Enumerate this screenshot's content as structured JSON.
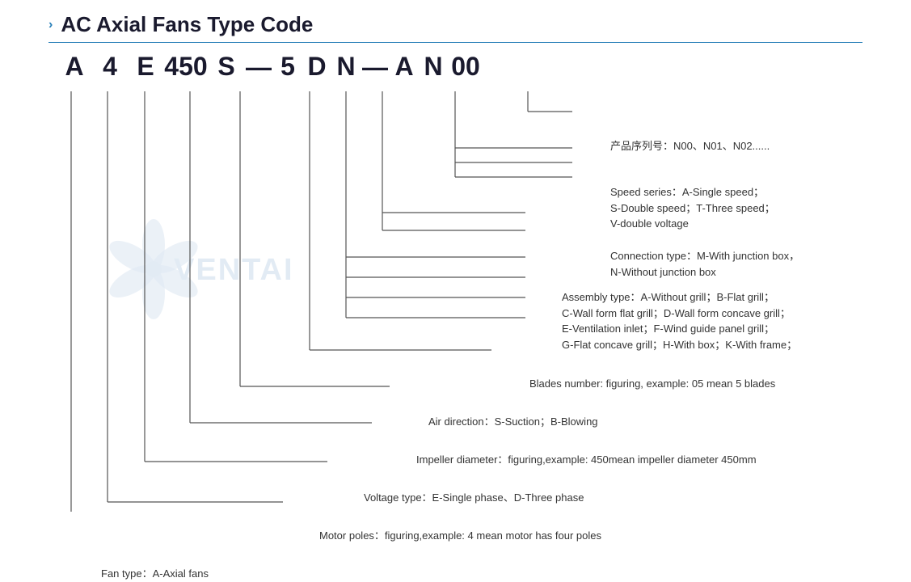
{
  "title": {
    "chevron": "›",
    "text": "AC Axial Fans Type Code"
  },
  "code_letters": [
    {
      "char": "A",
      "id": "fan-type"
    },
    {
      "char": "4",
      "id": "motor-poles"
    },
    {
      "char": "E",
      "id": "voltage-type"
    },
    {
      "char": "450",
      "id": "impeller-dia"
    },
    {
      "char": "S",
      "id": "air-direction"
    },
    {
      "char": "—",
      "id": "dash1"
    },
    {
      "char": "5",
      "id": "blades"
    },
    {
      "char": "D",
      "id": "assembly"
    },
    {
      "char": "N",
      "id": "connection"
    },
    {
      "char": "—",
      "id": "dash2"
    },
    {
      "char": "A",
      "id": "speed"
    },
    {
      "char": "N",
      "id": "speed2"
    },
    {
      "char": "00",
      "id": "product-series"
    }
  ],
  "labels": {
    "product_series": "产品序列号：N00、N01、N02......",
    "speed_title": "Speed series：A-Single speed；",
    "speed_line2": "S-Double speed；T-Three speed；",
    "speed_line3": "V-double voltage",
    "connection_title": "Connection type：M-With junction box，",
    "connection_line2": "N-Without junction box",
    "assembly_title": "Assembly type：A-Without grill；B-Flat grill；",
    "assembly_line2": "C-Wall form flat grill；D-Wall form concave grill；",
    "assembly_line3": "E-Ventilation inlet；F-Wind guide panel grill；",
    "assembly_line4": "G-Flat concave grill；H-With box；K-With frame；",
    "blades": "Blades number: figuring, example: 05 mean 5 blades",
    "air_direction": "Air direction：S-Suction；B-Blowing",
    "impeller": "Impeller diameter：figuring,example: 450mean impeller diameter 450mm",
    "voltage": "Voltage type：E-Single phase、D-Three phase",
    "motor_poles": "Motor poles：figuring,example: 4 mean motor has four poles",
    "fan_type": "Fan type：A-Axial fans"
  }
}
